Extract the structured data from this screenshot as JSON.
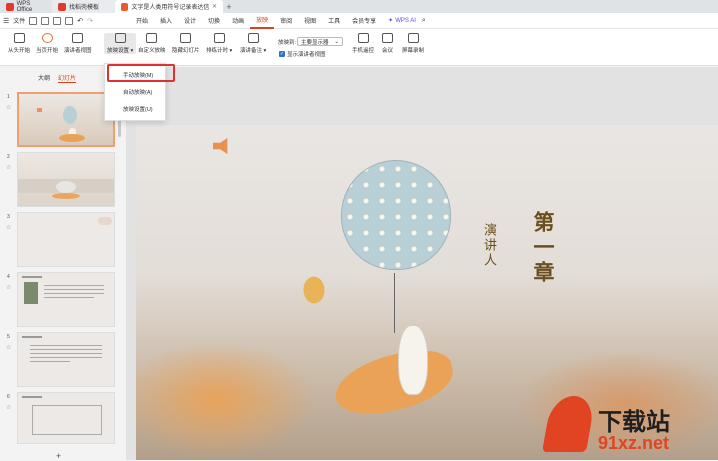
{
  "titlebar": {
    "tabs": [
      {
        "label": "WPS Office",
        "color": "#e03a2e"
      },
      {
        "label": "找稻壳模板",
        "color": "#e03a2e"
      },
      {
        "label": "文字是人类用符号记录表达信息以...",
        "color": "#e45d2b"
      }
    ]
  },
  "menubar": {
    "file": "文件",
    "items": [
      "开始",
      "插入",
      "设计",
      "切换",
      "动画",
      "放映",
      "审阅",
      "视图",
      "工具",
      "会员专享"
    ],
    "active": "放映",
    "ai": "WPS AI"
  },
  "toolbar": {
    "buttons": [
      "从头开始",
      "当页开始",
      "演讲者视图",
      "放映设置",
      "自定义放映",
      "隐藏幻灯片",
      "排练计时",
      "演讲备注",
      "手机遥控",
      "会议",
      "屏幕录制"
    ],
    "display_label": "放映到:",
    "display_value": "主要显示器",
    "presenter_check": "显示演讲者视图"
  },
  "dropdown": {
    "items": [
      "手动放映(M)",
      "自动放映(A)",
      "放映设置(U)"
    ]
  },
  "sidebar": {
    "tabs": [
      "大纲",
      "幻灯片"
    ],
    "slides": [
      "1",
      "2",
      "3",
      "4",
      "5",
      "6"
    ],
    "add": "+"
  },
  "slide": {
    "speaker": "演讲人",
    "chapter": "第一章"
  },
  "watermark": {
    "brand": "下载站",
    "url": "91xz.net"
  }
}
